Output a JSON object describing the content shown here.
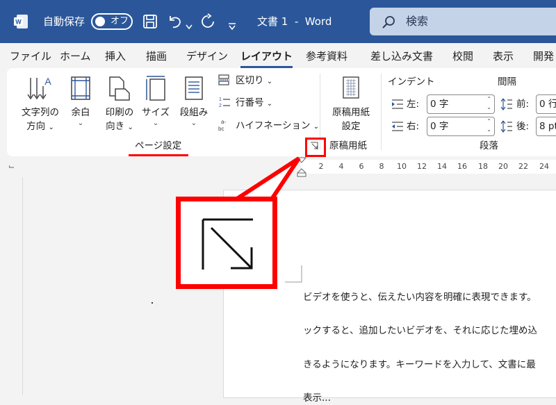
{
  "titlebar": {
    "autosave_label": "自動保存",
    "toggle_label": "オフ",
    "doc_title": "文書 1  -  Word",
    "search_placeholder": "検索"
  },
  "tabs": [
    {
      "label": "ファイル"
    },
    {
      "label": "ホーム"
    },
    {
      "label": "挿入"
    },
    {
      "label": "描画"
    },
    {
      "label": "デザイン"
    },
    {
      "label": "レイアウト"
    },
    {
      "label": "参考資料"
    },
    {
      "label": "差し込み文書"
    },
    {
      "label": "校閲"
    },
    {
      "label": "表示"
    },
    {
      "label": "開発"
    }
  ],
  "ribbon": {
    "text_direction": [
      "文字列の",
      "方向"
    ],
    "margins": "余白",
    "orientation": [
      "印刷の",
      "向き"
    ],
    "size": "サイズ",
    "columns": "段組み",
    "breaks": "区切り",
    "line_numbers": "行番号",
    "hyphenation": "ハイフネーション",
    "page_setup_group": "ページ設定",
    "manuscript_btn": [
      "原稿用紙",
      "設定"
    ],
    "manuscript_group": "原稿用紙",
    "indent_header": "インデント",
    "spacing_header": "間隔",
    "indent_left_label": "左:",
    "indent_left_value": "0 字",
    "indent_right_label": "右:",
    "indent_right_value": "0 字",
    "spacing_before_label": "前:",
    "spacing_before_value": "0 行",
    "spacing_after_label": "後:",
    "spacing_after_value": "8 pt",
    "paragraph_group": "段落"
  },
  "ruler": {
    "ticks": [
      "2",
      "4",
      "6",
      "8",
      "10",
      "12",
      "14",
      "16",
      "18",
      "20",
      "22",
      "24"
    ]
  },
  "document": {
    "lines": [
      "ビデオを使うと、伝えたい内容を明確に表現できます。",
      "ックすると、追加したいビデオを、それに応じた埋め込",
      "きるようになります。キーワードを入力して、文書に最",
      "表示..."
    ]
  },
  "colors": {
    "titlebar": "#2b579a",
    "highlight": "#ff0000"
  }
}
